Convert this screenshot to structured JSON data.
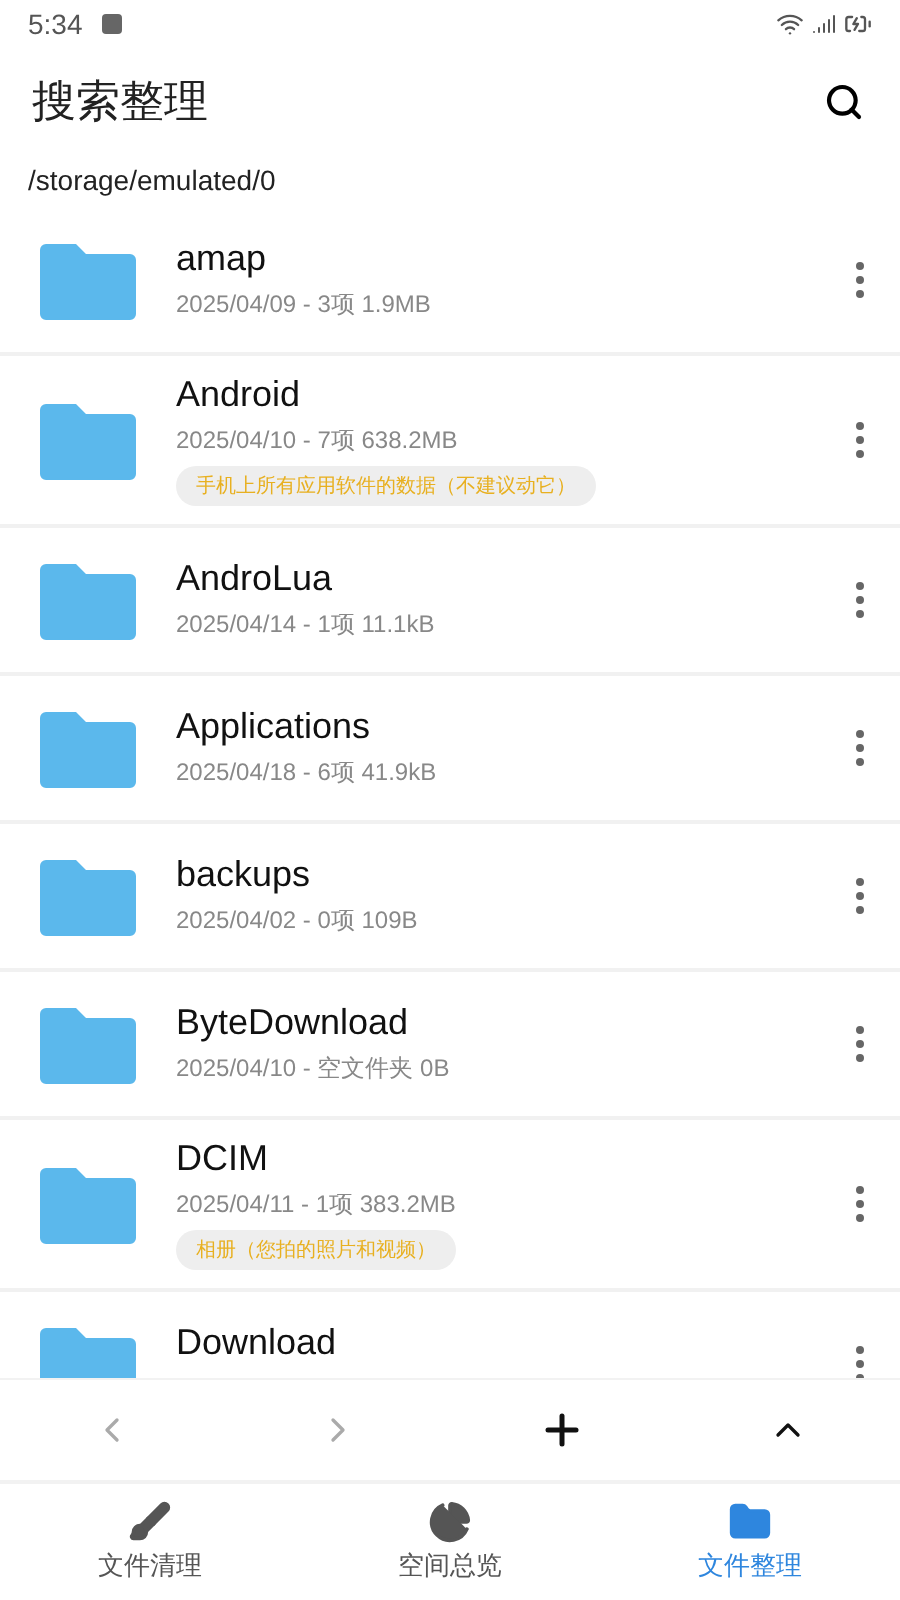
{
  "status_bar": {
    "time": "5:34"
  },
  "app_bar": {
    "title": "搜索整理"
  },
  "path": "/storage/emulated/0",
  "folders": [
    {
      "name": "amap",
      "meta": "2025/04/09 - 3项 1.9MB"
    },
    {
      "name": "Android",
      "meta": "2025/04/10 - 7项 638.2MB",
      "tag": "手机上所有应用软件的数据（不建议动它）"
    },
    {
      "name": "AndroLua",
      "meta": "2025/04/14 - 1项 11.1kB"
    },
    {
      "name": "Applications",
      "meta": "2025/04/18 - 6项 41.9kB"
    },
    {
      "name": "backups",
      "meta": "2025/04/02 - 0项 109B"
    },
    {
      "name": "ByteDownload",
      "meta": "2025/04/10 - 空文件夹 0B"
    },
    {
      "name": "DCIM",
      "meta": "2025/04/11 - 1项 383.2MB",
      "tag": "相册（您拍的照片和视频）"
    },
    {
      "name": "Download"
    }
  ],
  "toolbar": [
    {
      "kind": "back",
      "disabled": true
    },
    {
      "kind": "forward",
      "disabled": true
    },
    {
      "kind": "add",
      "disabled": false
    },
    {
      "kind": "up",
      "disabled": false
    }
  ],
  "nav": [
    {
      "kind": "clean",
      "label": "文件清理",
      "selected": false
    },
    {
      "kind": "overview",
      "label": "空间总览",
      "selected": false
    },
    {
      "kind": "files",
      "label": "文件整理",
      "selected": true
    }
  ]
}
